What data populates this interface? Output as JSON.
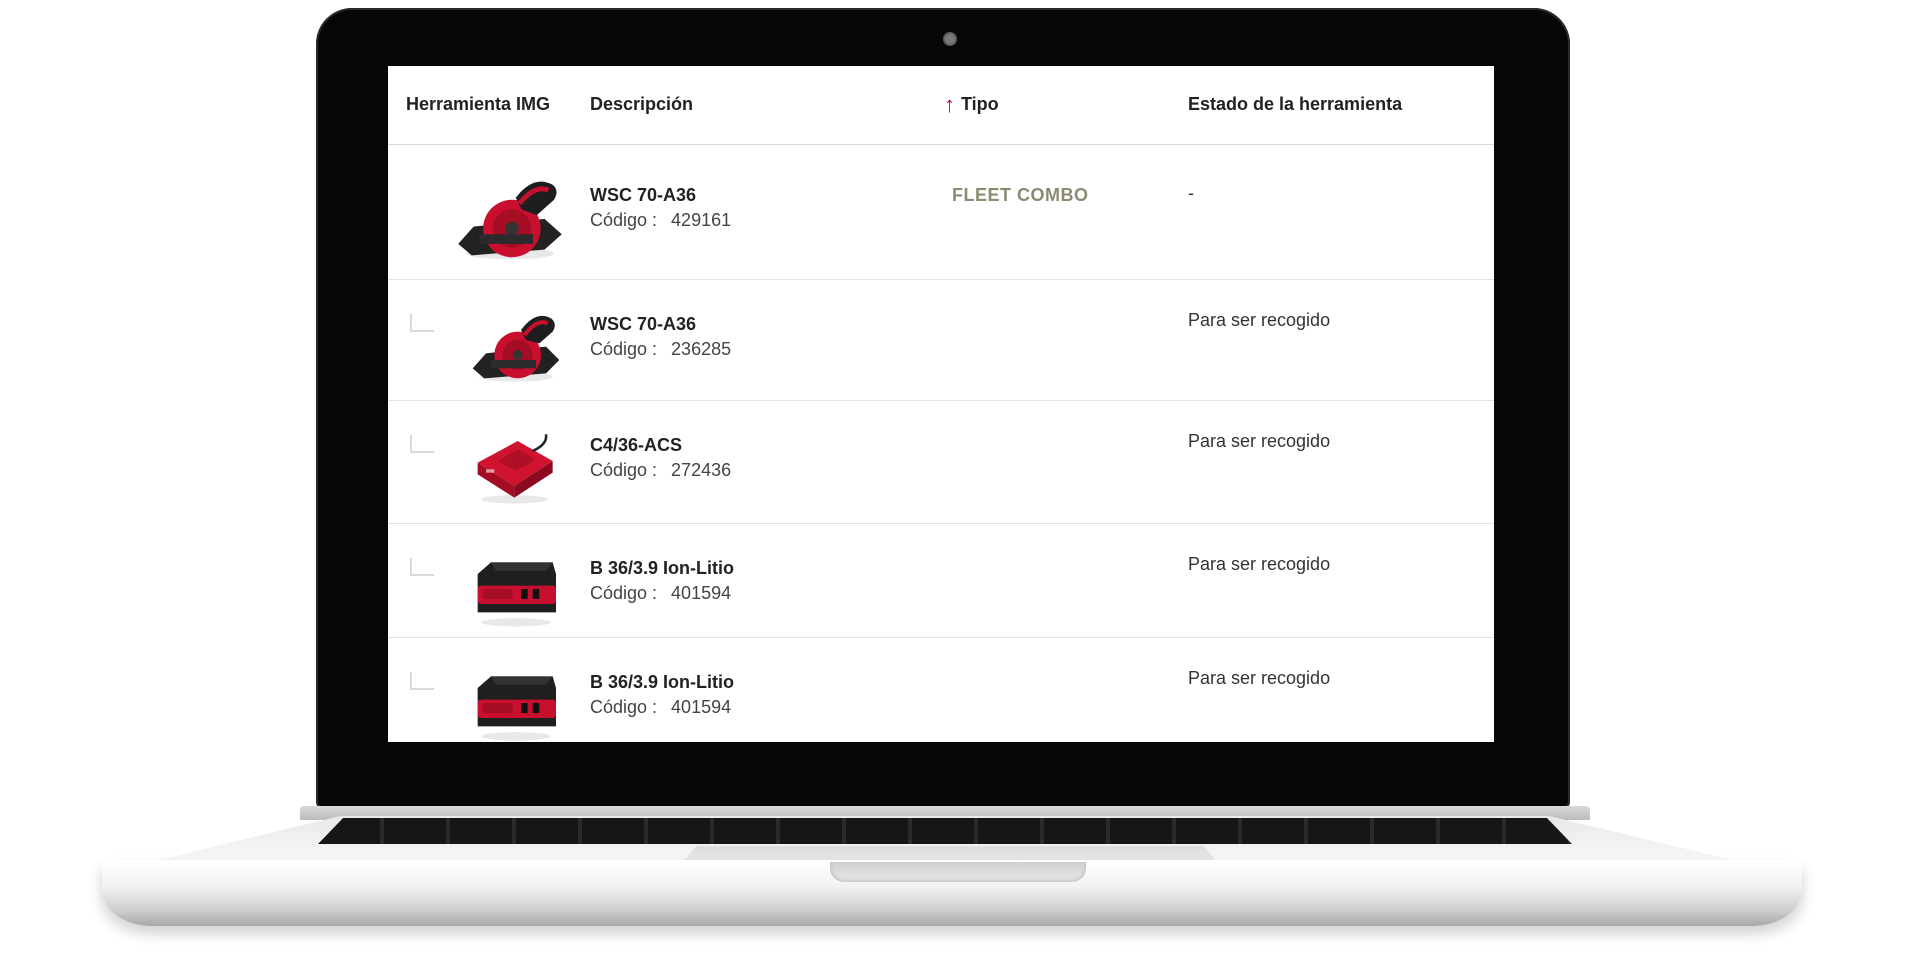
{
  "table": {
    "headers": {
      "image": "Herramienta IMG",
      "description": "Descripción",
      "type": "Tipo",
      "state": "Estado de la herramienta"
    },
    "sort": {
      "column": "type",
      "direction": "ascending"
    },
    "code_label": "Código :",
    "rows": [
      {
        "name": "WSC 70-A36",
        "code": "429161",
        "type": "FLEET COMBO",
        "state": "-",
        "child": false,
        "image": "circular-saw-icon"
      },
      {
        "name": "WSC 70-A36",
        "code": "236285",
        "type": "",
        "state": "Para ser recogido",
        "child": true,
        "image": "circular-saw-icon"
      },
      {
        "name": "C4/36-ACS",
        "code": "272436",
        "type": "",
        "state": "Para ser recogido",
        "child": true,
        "image": "battery-charger-icon"
      },
      {
        "name": "B 36/3.9 Ion-Litio",
        "code": "401594",
        "type": "",
        "state": "Para ser recogido",
        "child": true,
        "image": "battery-pack-icon"
      },
      {
        "name": "B 36/3.9 Ion-Litio",
        "code": "401594",
        "type": "",
        "state": "Para ser recogido",
        "child": true,
        "image": "battery-pack-icon"
      }
    ]
  },
  "colors": {
    "accent": "#d2051e",
    "product_red": "#c8102e",
    "type_text": "#8b8b72"
  }
}
